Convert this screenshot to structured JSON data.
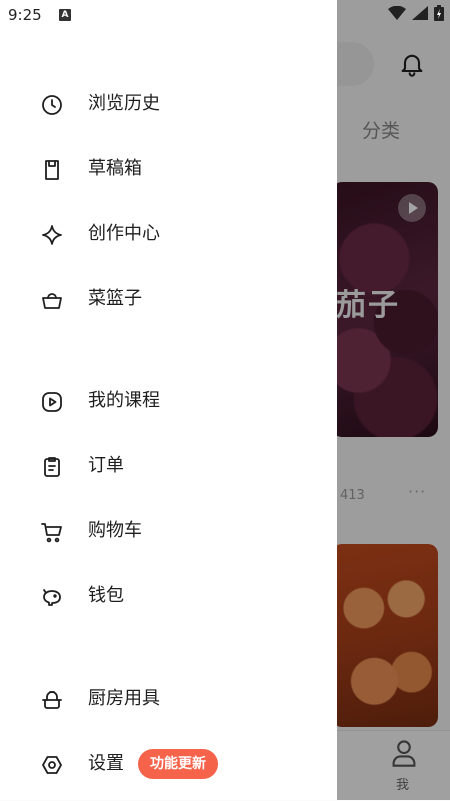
{
  "status_bar": {
    "time": "9:25",
    "notification_letter": "A"
  },
  "drawer": {
    "groups": [
      [
        {
          "label": "浏览历史",
          "icon": "clock-icon"
        },
        {
          "label": "草稿箱",
          "icon": "draft-icon"
        },
        {
          "label": "创作中心",
          "icon": "sparkle-icon"
        },
        {
          "label": "菜篮子",
          "icon": "basket-icon"
        }
      ],
      [
        {
          "label": "我的课程",
          "icon": "play-course-icon"
        },
        {
          "label": "订单",
          "icon": "clipboard-icon"
        },
        {
          "label": "购物车",
          "icon": "cart-icon"
        },
        {
          "label": "钱包",
          "icon": "piggy-bank-icon"
        }
      ],
      [
        {
          "label": "厨房用具",
          "icon": "kitchenware-icon"
        },
        {
          "label": "设置",
          "icon": "settings-icon",
          "badge": "功能更新"
        }
      ]
    ]
  },
  "background": {
    "tab_label": "分类",
    "card1_text": "茄子",
    "card1_count": "413",
    "card1_more": "···",
    "bottom_nav_me": "我"
  },
  "colors": {
    "badge": "#f5634a",
    "drawer_bg": "#ffffff",
    "scrim": "rgba(0,0,0,0.36)"
  }
}
